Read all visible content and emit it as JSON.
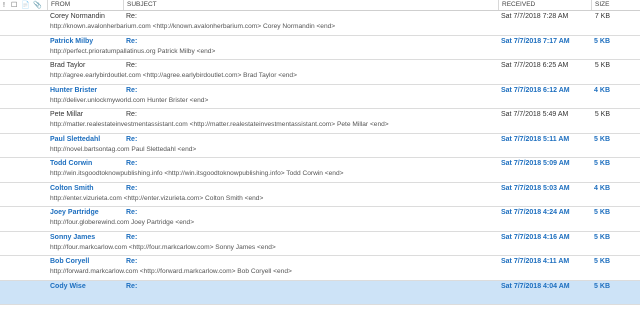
{
  "header": {
    "icons": [
      "!",
      "☐",
      "📄",
      "📎"
    ],
    "from": "FROM",
    "subject": "SUBJECT",
    "received": "RECEIVED",
    "size": "SIZE"
  },
  "emails": [
    {
      "from": "Corey Normandin",
      "subject": "Re:",
      "received": "Sat 7/7/2018 7:28 AM",
      "size": "7 KB",
      "preview": "http://known.avalonherbarium.com <http://known.avalonherbarium.com>    Corey Normandin <end>",
      "unread": false
    },
    {
      "from": "Patrick Milby",
      "subject": "Re:",
      "received": "Sat 7/7/2018 7:17 AM",
      "size": "5 KB",
      "preview": "http://perfect.prioratumpallatinus.org  Patrick Milby <end>",
      "unread": true
    },
    {
      "from": "Brad Taylor",
      "subject": "Re:",
      "received": "Sat 7/7/2018 6:25 AM",
      "size": "5 KB",
      "preview": "http://agree.earlybirdoutlet.com <http://agree.earlybirdoutlet.com>    Brad Taylor <end>",
      "unread": false
    },
    {
      "from": "Hunter Brister",
      "subject": "Re:",
      "received": "Sat 7/7/2018 6:12 AM",
      "size": "4 KB",
      "preview": "http://deliver.unlockmyworld.com  Hunter Brister <end>",
      "unread": true
    },
    {
      "from": "Pete Millar",
      "subject": "Re:",
      "received": "Sat 7/7/2018 5:49 AM",
      "size": "5 KB",
      "preview": "http://matter.realestateinvestmentassistant.com <http://matter.realestateinvestmentassistant.com>    Pete Millar <end>",
      "unread": false
    },
    {
      "from": "Paul Slettedahl",
      "subject": "Re:",
      "received": "Sat 7/7/2018 5:11 AM",
      "size": "5 KB",
      "preview": "http://novel.bartsontag.com  Paul Slettedahl <end>",
      "unread": true
    },
    {
      "from": "Todd Corwin",
      "subject": "Re:",
      "received": "Sat 7/7/2018 5:09 AM",
      "size": "5 KB",
      "preview": "http://win.itsgoodtoknowpublishing.info <http://win.itsgoodtoknowpublishing.info>    Todd Corwin <end>",
      "unread": true
    },
    {
      "from": "Colton Smith",
      "subject": "Re:",
      "received": "Sat 7/7/2018 5:03 AM",
      "size": "4 KB",
      "preview": "http://enter.vizurieta.com <http://enter.vizurieta.com>    Colton Smith <end>",
      "unread": true
    },
    {
      "from": "Joey Partridge",
      "subject": "Re:",
      "received": "Sat 7/7/2018 4:24 AM",
      "size": "5 KB",
      "preview": "http://four.globerewind.com  Joey Partridge <end>",
      "unread": true
    },
    {
      "from": "Sonny James",
      "subject": "Re:",
      "received": "Sat 7/7/2018 4:16 AM",
      "size": "5 KB",
      "preview": "http://four.markcarlow.com <http://four.markcarlow.com>    Sonny James <end>",
      "unread": true
    },
    {
      "from": "Bob Coryell",
      "subject": "Re:",
      "received": "Sat 7/7/2018 4:11 AM",
      "size": "5 KB",
      "preview": "http://forward.markcarlow.com <http://forward.markcarlow.com>    Bob Coryell <end>",
      "unread": true
    },
    {
      "from": "Cody Wise",
      "subject": "Re:",
      "received": "Sat 7/7/2018 4:04 AM",
      "size": "5 KB",
      "preview": "",
      "unread": true,
      "selected": true
    }
  ]
}
